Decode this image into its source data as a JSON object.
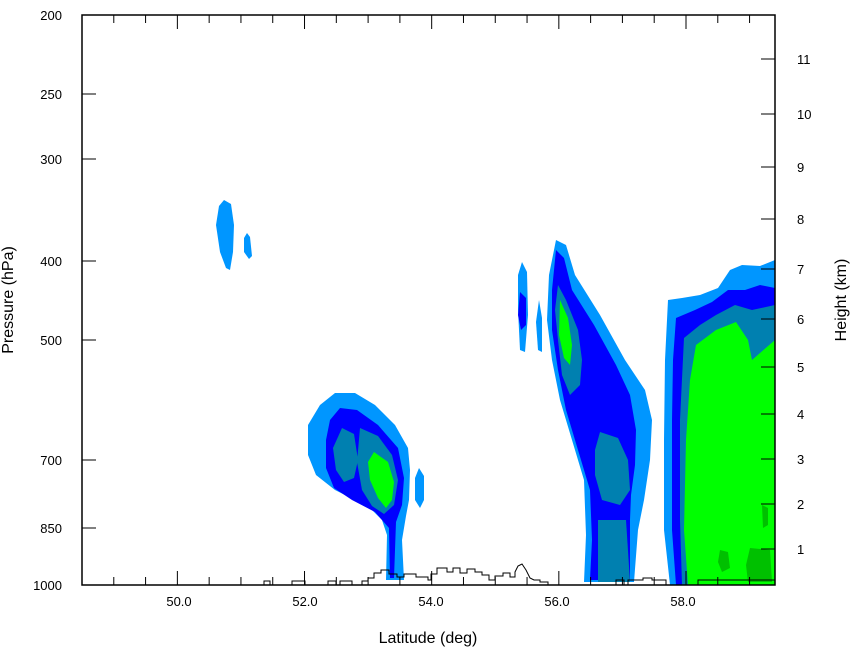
{
  "chart_data": {
    "type": "contour",
    "xlabel": "Latitude (deg)",
    "ylabel_left": "Pressure (hPa)",
    "ylabel_right": "Height (km)",
    "xlim": [
      48.5,
      59.4
    ],
    "x_ticks": [
      "50.0",
      "52.0",
      "54.0",
      "56.0",
      "58.0"
    ],
    "y_ticks": [
      "200",
      "250",
      "300",
      "400",
      "500",
      "700",
      "850",
      "1000"
    ],
    "height_ticks": [
      "1",
      "2",
      "3",
      "4",
      "5",
      "6",
      "7",
      "8",
      "9",
      "10",
      "11"
    ],
    "grid": false,
    "legend": "none",
    "colors": {
      "level1": "#0096ff",
      "level2": "#0000ff",
      "level3": "#0080b0",
      "level4": "#00ff00",
      "level5": "#00c000",
      "terrain": "#000000"
    }
  }
}
